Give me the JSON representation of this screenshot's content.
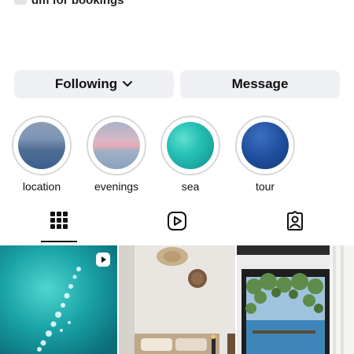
{
  "header": {
    "partial_text": "dm for bookings"
  },
  "actions": {
    "following_label": "Following",
    "message_label": "Message"
  },
  "highlights": [
    {
      "label": "location"
    },
    {
      "label": "evenings"
    },
    {
      "label": "sea"
    },
    {
      "label": "tour"
    }
  ],
  "tabs": [
    {
      "icon": "grid-icon",
      "active": true
    },
    {
      "icon": "reels-icon",
      "active": false
    },
    {
      "icon": "tagged-icon",
      "active": false
    }
  ],
  "posts": [
    {
      "kind": "video",
      "subject": "sea water"
    },
    {
      "kind": "image",
      "subject": "bedroom"
    },
    {
      "kind": "image",
      "subject": "window sea view"
    }
  ]
}
